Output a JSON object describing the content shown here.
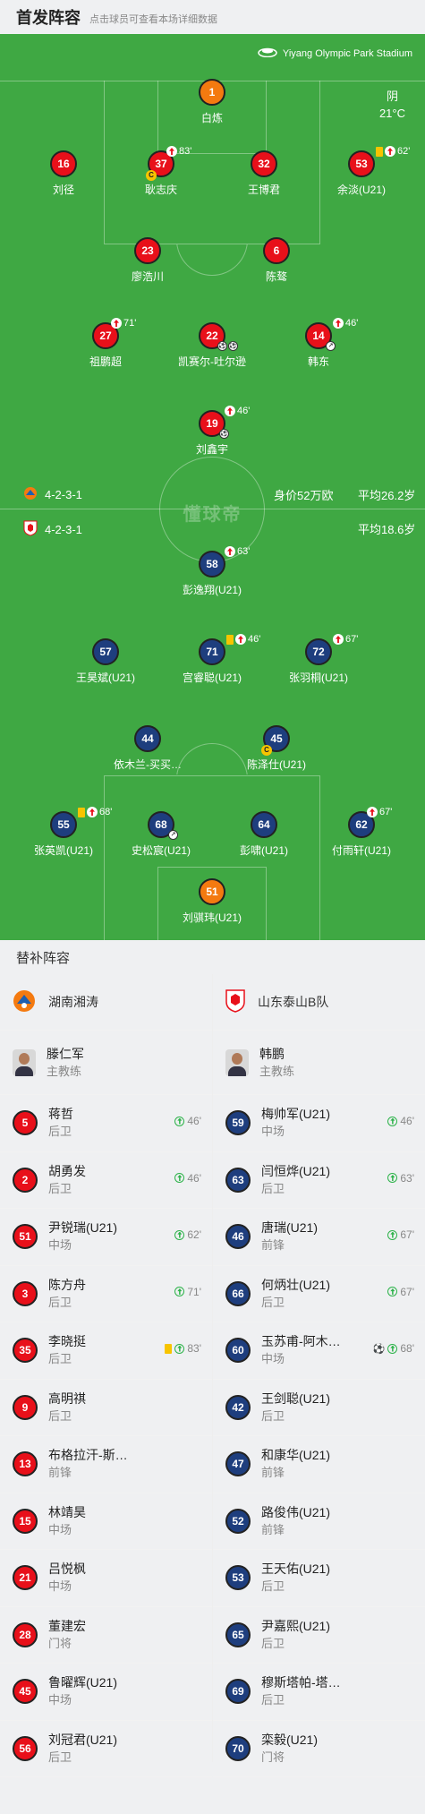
{
  "header": {
    "title": "首发阵容",
    "subtitle": "点击球员可查看本场详细数据"
  },
  "pitch": {
    "venue": "Yiyang Olympic Park Stadium",
    "weather": {
      "condition": "阴",
      "temperature": "21°C"
    },
    "watermark": "懂球帝",
    "home_info": {
      "formation": "4-2-3-1",
      "value": "身价52万欧",
      "avg_age": "平均26.2岁"
    },
    "away_info": {
      "formation": "4-2-3-1",
      "avg_age": "平均18.6岁"
    }
  },
  "home_players": [
    {
      "num": "1",
      "name": "白炼"
    },
    {
      "num": "16",
      "name": "刘径"
    },
    {
      "num": "37",
      "name": "耿志庆",
      "sub": "83'"
    },
    {
      "num": "32",
      "name": "王博君"
    },
    {
      "num": "53",
      "name": "余淡(U21)",
      "sub": "62'"
    },
    {
      "num": "23",
      "name": "廖浩川"
    },
    {
      "num": "6",
      "name": "陈骜"
    },
    {
      "num": "27",
      "name": "祖鹏超",
      "sub": "71'"
    },
    {
      "num": "22",
      "name": "凯赛尔-吐尔逊"
    },
    {
      "num": "14",
      "name": "韩东",
      "sub": "46'"
    },
    {
      "num": "19",
      "name": "刘鑫宇",
      "sub": "46'"
    }
  ],
  "away_players": [
    {
      "num": "58",
      "name": "彭逸翔(U21)",
      "sub": "63'"
    },
    {
      "num": "57",
      "name": "王昊斌(U21)"
    },
    {
      "num": "71",
      "name": "宫睿聪(U21)",
      "sub": "46'"
    },
    {
      "num": "72",
      "name": "张羽桐(U21)",
      "sub": "67'"
    },
    {
      "num": "44",
      "name": "依木兰-买买…"
    },
    {
      "num": "45",
      "name": "陈泽仕(U21)"
    },
    {
      "num": "55",
      "name": "张英凯(U21)",
      "sub": "68'"
    },
    {
      "num": "68",
      "name": "史松宸(U21)"
    },
    {
      "num": "64",
      "name": "彭啸(U21)"
    },
    {
      "num": "62",
      "name": "付雨轩(U21)",
      "sub": "67'"
    },
    {
      "num": "51",
      "name": "刘骐玮(U21)"
    }
  ],
  "bench": {
    "title": "替补阵容",
    "home": {
      "team": "湖南湘涛",
      "coach": {
        "name": "滕仁军",
        "role": "主教练"
      },
      "players": [
        {
          "num": "5",
          "name": "蒋哲",
          "pos": "后卫",
          "time": "46'"
        },
        {
          "num": "2",
          "name": "胡勇发",
          "pos": "后卫",
          "time": "46'"
        },
        {
          "num": "51",
          "name": "尹锐瑞(U21)",
          "pos": "中场",
          "time": "62'"
        },
        {
          "num": "3",
          "name": "陈方舟",
          "pos": "后卫",
          "time": "71'"
        },
        {
          "num": "35",
          "name": "李晓挺",
          "pos": "后卫",
          "time": "83'"
        },
        {
          "num": "9",
          "name": "高明祺",
          "pos": "后卫"
        },
        {
          "num": "13",
          "name": "布格拉汗-斯…",
          "pos": "前锋"
        },
        {
          "num": "15",
          "name": "林靖昊",
          "pos": "中场"
        },
        {
          "num": "21",
          "name": "吕悦枫",
          "pos": "中场"
        },
        {
          "num": "28",
          "name": "董建宏",
          "pos": "门将"
        },
        {
          "num": "45",
          "name": "鲁曜辉(U21)",
          "pos": "中场"
        },
        {
          "num": "56",
          "name": "刘冠君(U21)",
          "pos": "后卫"
        }
      ]
    },
    "away": {
      "team": "山东泰山B队",
      "coach": {
        "name": "韩鹏",
        "role": "主教练"
      },
      "players": [
        {
          "num": "59",
          "name": "梅帅军(U21)",
          "pos": "中场",
          "time": "46'"
        },
        {
          "num": "63",
          "name": "闫恒烨(U21)",
          "pos": "后卫",
          "time": "63'"
        },
        {
          "num": "46",
          "name": "唐瑞(U21)",
          "pos": "前锋",
          "time": "67'"
        },
        {
          "num": "66",
          "name": "何炳壮(U21)",
          "pos": "后卫",
          "time": "67'"
        },
        {
          "num": "60",
          "name": "玉苏甫-阿木…",
          "pos": "中场",
          "time": "68'"
        },
        {
          "num": "42",
          "name": "王剑聪(U21)",
          "pos": "后卫"
        },
        {
          "num": "47",
          "name": "和康华(U21)",
          "pos": "前锋"
        },
        {
          "num": "52",
          "name": "路俊伟(U21)",
          "pos": "前锋"
        },
        {
          "num": "53",
          "name": "王天佑(U21)",
          "pos": "后卫"
        },
        {
          "num": "65",
          "name": "尹嘉熙(U21)",
          "pos": "后卫"
        },
        {
          "num": "69",
          "name": "穆斯塔帕-塔…",
          "pos": "后卫"
        },
        {
          "num": "70",
          "name": "栾毅(U21)",
          "pos": "门将"
        }
      ]
    }
  }
}
